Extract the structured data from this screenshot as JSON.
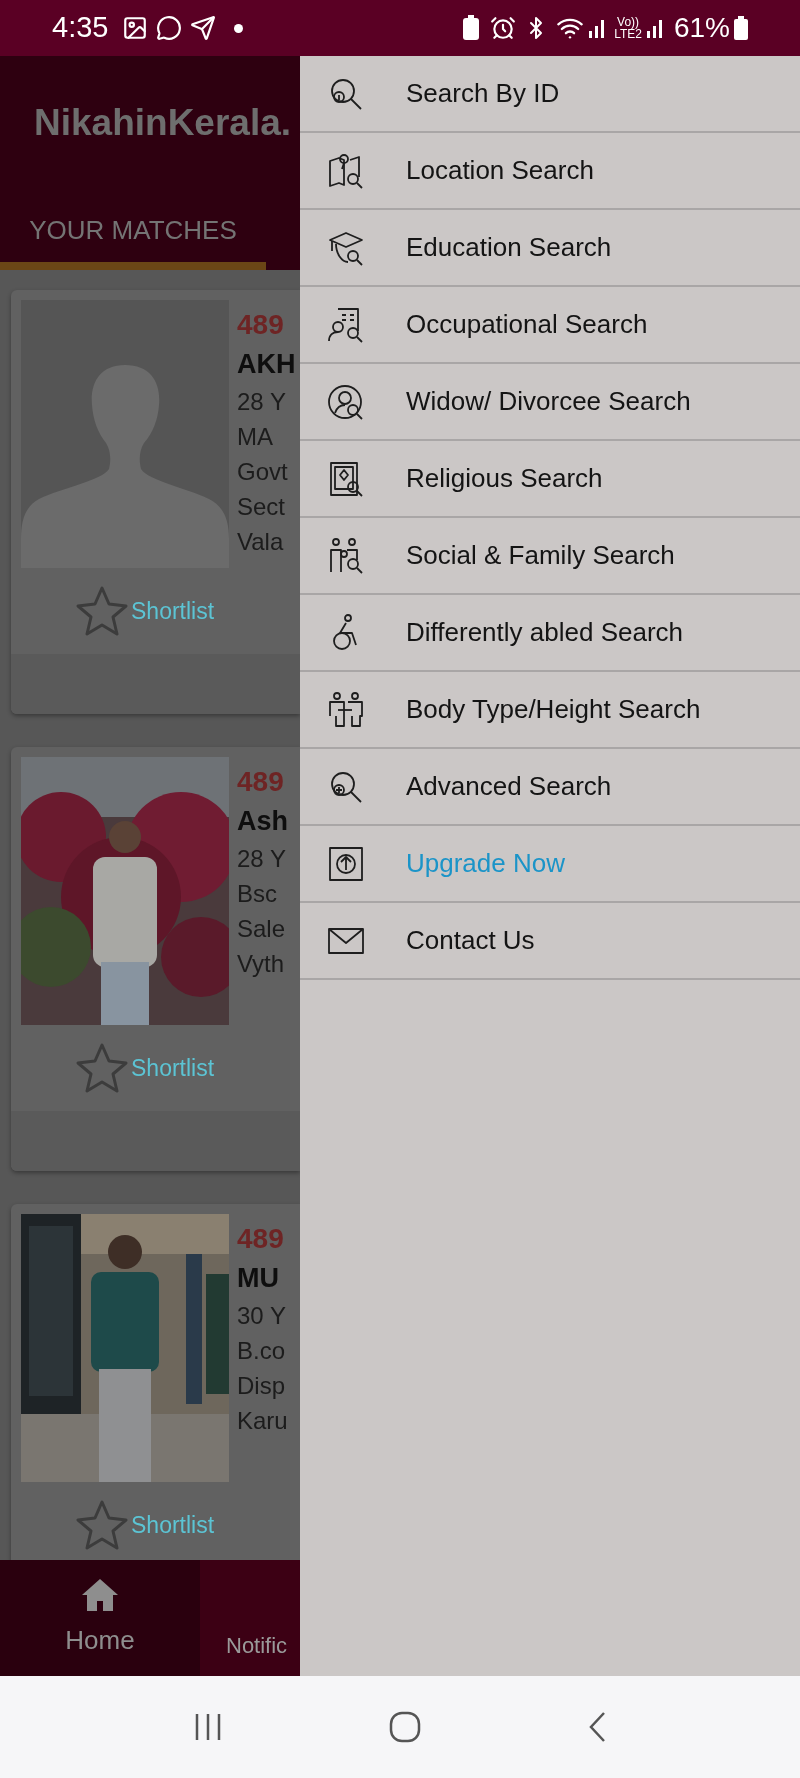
{
  "status_bar": {
    "time": "4:35",
    "network_label": [
      "Vo))",
      "LTE2"
    ],
    "battery": "61%"
  },
  "header": {
    "title": "NikahinKerala."
  },
  "tabs": [
    {
      "label": "YOUR MATCHES",
      "selected": true
    }
  ],
  "cards": [
    {
      "photo": {
        "kind": "placeholder"
      },
      "id": "489",
      "name": "AKH",
      "lines": [
        "28 Y",
        "MA",
        "Govt",
        "Sect",
        "Vala"
      ],
      "shortlist": "Shortlist"
    },
    {
      "photo": {
        "kind": "picture"
      },
      "id": "489",
      "name": "Ash",
      "lines": [
        "28 Y",
        "Bsc",
        "Sale",
        "Vyth"
      ],
      "shortlist": "Shortlist"
    },
    {
      "photo": {
        "kind": "picture"
      },
      "id": "489",
      "name": "MU",
      "lines": [
        "30 Y",
        "B.co",
        "Disp",
        "Karu"
      ],
      "shortlist": "Shortlist"
    }
  ],
  "bottom_nav": [
    {
      "label": "Home",
      "kind": "home",
      "selected": true
    },
    {
      "label": "Notific",
      "kind": "text",
      "selected": false
    }
  ],
  "drawer": {
    "items": [
      {
        "label": "Search By ID",
        "kind": "id",
        "accent": false
      },
      {
        "label": "Location Search",
        "kind": "map",
        "accent": false
      },
      {
        "label": "Education Search",
        "kind": "education",
        "accent": false
      },
      {
        "label": "Occupational Search",
        "kind": "occupation",
        "accent": false
      },
      {
        "label": "Widow/ Divorcee Search",
        "kind": "person",
        "accent": false
      },
      {
        "label": "Religious Search",
        "kind": "book",
        "accent": false
      },
      {
        "label": "Social & Family Search",
        "kind": "family",
        "accent": false
      },
      {
        "label": "Differently abled Search",
        "kind": "wheelchair",
        "accent": false
      },
      {
        "label": "Body Type/Height Search",
        "kind": "body",
        "accent": false
      },
      {
        "label": "Advanced Search",
        "kind": "advanced",
        "accent": false
      },
      {
        "label": "Upgrade Now",
        "kind": "upgrade",
        "accent": true
      },
      {
        "label": "Contact Us",
        "kind": "mail",
        "accent": false
      }
    ]
  }
}
